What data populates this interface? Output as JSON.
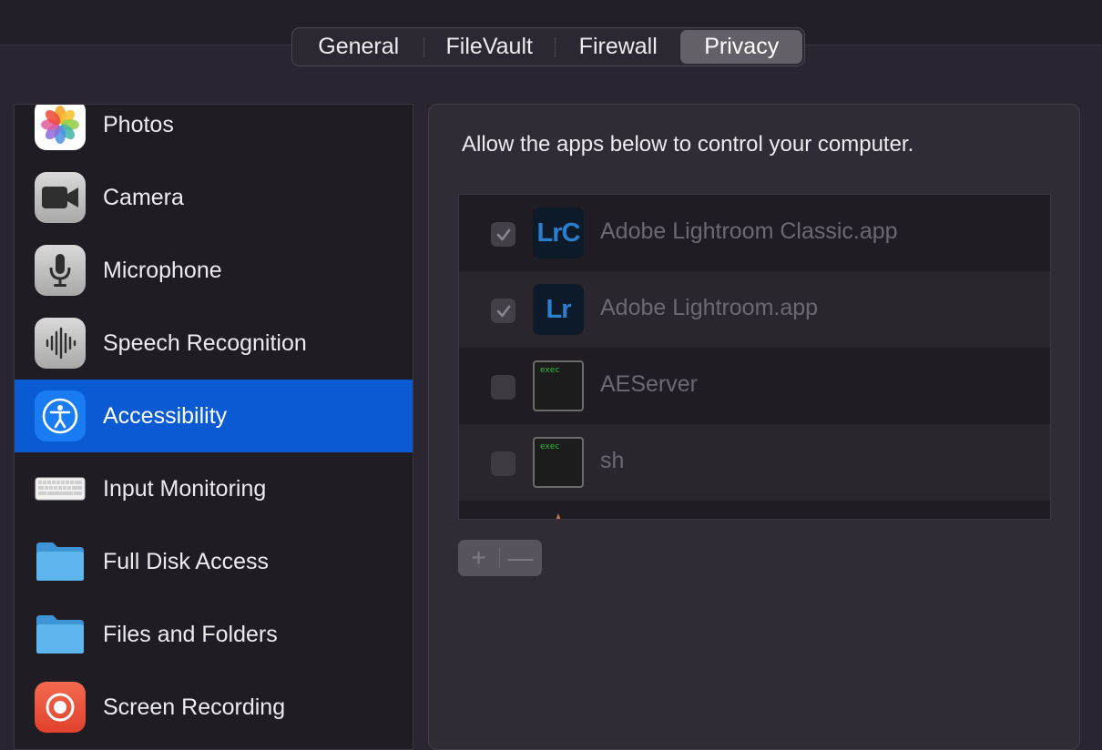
{
  "tabs": [
    {
      "label": "General",
      "selected": false
    },
    {
      "label": "FileVault",
      "selected": false
    },
    {
      "label": "Firewall",
      "selected": false
    },
    {
      "label": "Privacy",
      "selected": true
    }
  ],
  "sidebar": {
    "items": [
      {
        "label": "Photos",
        "icon": "photos-icon"
      },
      {
        "label": "Camera",
        "icon": "camera-icon"
      },
      {
        "label": "Microphone",
        "icon": "microphone-icon"
      },
      {
        "label": "Speech Recognition",
        "icon": "waveform-icon"
      },
      {
        "label": "Accessibility",
        "icon": "accessibility-icon",
        "selected": true
      },
      {
        "label": "Input Monitoring",
        "icon": "keyboard-icon"
      },
      {
        "label": "Full Disk Access",
        "icon": "folder-icon"
      },
      {
        "label": "Files and Folders",
        "icon": "folder-icon"
      },
      {
        "label": "Screen Recording",
        "icon": "screen-recording-icon"
      }
    ]
  },
  "panel": {
    "description": "Allow the apps below to control your computer.",
    "apps": [
      {
        "name": "Adobe Lightroom Classic.app",
        "icon_text": "LrC",
        "checked": true
      },
      {
        "name": "Adobe Lightroom.app",
        "icon_text": "Lr",
        "checked": true
      },
      {
        "name": "AEServer",
        "icon_text": "exec",
        "checked": false
      },
      {
        "name": "sh",
        "icon_text": "exec",
        "checked": false
      }
    ],
    "add_symbol": "+",
    "remove_symbol": "—"
  },
  "colors": {
    "selection": "#0a5bd3",
    "window_bg": "#2a2530",
    "lightroom_blue": "#2c7fce"
  }
}
